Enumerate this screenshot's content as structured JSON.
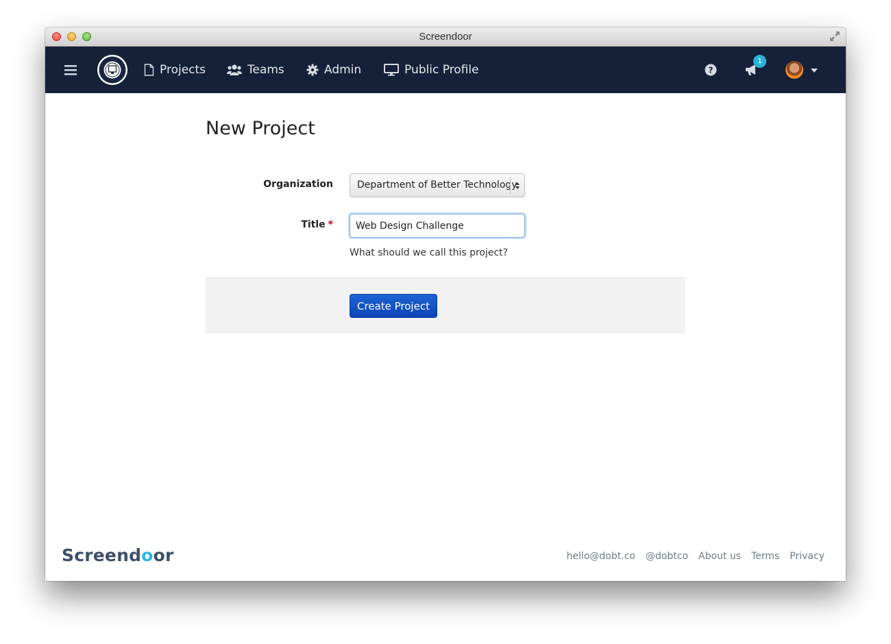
{
  "window": {
    "title": "Screendoor"
  },
  "nav": {
    "items": [
      {
        "label": "Projects",
        "icon": "document-icon"
      },
      {
        "label": "Teams",
        "icon": "users-icon"
      },
      {
        "label": "Admin",
        "icon": "gear-icon"
      },
      {
        "label": "Public Profile",
        "icon": "monitor-icon"
      }
    ],
    "notification_count": "1",
    "colors": {
      "navbar": "#152138",
      "badge": "#2bb4d6"
    }
  },
  "page": {
    "title": "New Project"
  },
  "form": {
    "organization_label": "Organization",
    "organization_value": "Department of Better Technology",
    "title_label": "Title",
    "title_required_mark": "*",
    "title_value": "Web Design Challenge",
    "title_help": "What should we call this project?",
    "submit_label": "Create Project",
    "colors": {
      "primary_button": "#1659c9",
      "required": "#b0001d"
    }
  },
  "footer": {
    "logo_prefix": "Screend",
    "logo_accent": "o",
    "logo_suffix": "or",
    "links": [
      "hello@dobt.co",
      "@dobtco",
      "About us",
      "Terms",
      "Privacy"
    ],
    "colors": {
      "logo": "#3d4f68",
      "accent": "#2fb5e6"
    }
  }
}
